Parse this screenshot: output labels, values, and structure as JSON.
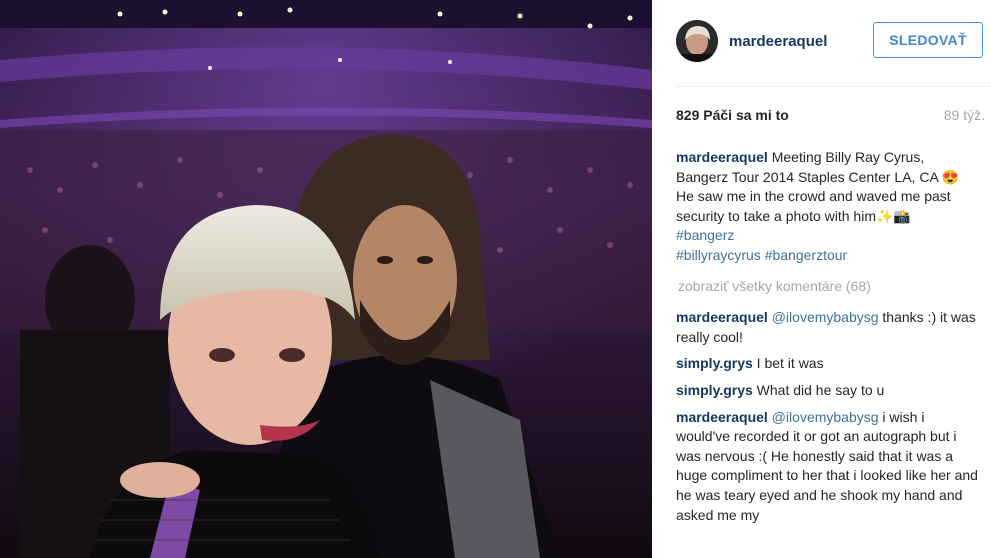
{
  "post": {
    "author": {
      "username": "mardeeraquel",
      "follow_label": "SLEDOVAŤ"
    },
    "likes": "829 Páči sa mi to",
    "age": "89 týž.",
    "caption": {
      "username": "mardeeraquel",
      "line1": "Meeting Billy Ray Cyrus, Bangerz Tour 2014 Staples Center LA, CA 😍",
      "line2": "He saw me in the crowd and waved me past security to take a photo with him✨📸",
      "hashtag1": "#bangerz",
      "hashtag2": "#billyraycyrus",
      "hashtag3": "#bangerztour"
    },
    "view_all_comments": "zobraziť všetky komentáre (68)",
    "comments": [
      {
        "username": "mardeeraquel",
        "mention": "@ilovemybabysg",
        "text": " thanks :) it was really cool!"
      },
      {
        "username": "simply.grys",
        "mention": "",
        "text": " I bet it was"
      },
      {
        "username": "simply.grys",
        "mention": "",
        "text": " What did he say to u"
      },
      {
        "username": "mardeeraquel",
        "mention": "@ilovemybabysg",
        "text": " i wish i would've recorded it or got an autograph but i was nervous :( He honestly said that it was a huge compliment to her that i looked like her and he was teary eyed and he shook my hand and asked me my"
      }
    ]
  },
  "colors": {
    "username": "#12385f",
    "link": "#3f729b",
    "muted": "#a5a7aa",
    "follow_border": "#4a8fd6"
  }
}
